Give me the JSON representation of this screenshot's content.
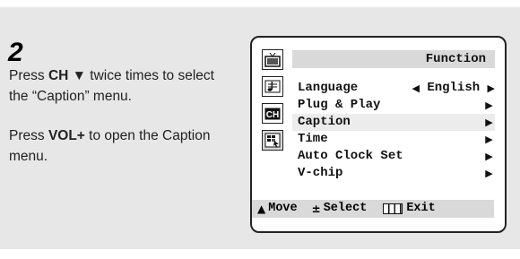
{
  "step": {
    "number": "2"
  },
  "instructions": [
    {
      "before": "Press ",
      "bold": "CH ▼",
      "after": " twice times to select the “Caption” menu."
    },
    {
      "before": "Press ",
      "bold": "VOL+",
      "after": " to open the Caption menu."
    }
  ],
  "osd": {
    "icons": [
      "tv-picture-icon",
      "music-note-icon",
      "ch-icon",
      "function-grid-icon"
    ],
    "active_icon": "function-grid-icon",
    "menu_title": "Function",
    "items": [
      {
        "label": "Language",
        "value": "English",
        "has_left_arrow": true
      },
      {
        "label": "Plug & Play",
        "value": "",
        "has_left_arrow": false
      },
      {
        "label": "Caption",
        "value": "",
        "has_left_arrow": false,
        "selected": true
      },
      {
        "label": "Time",
        "value": "",
        "has_left_arrow": false
      },
      {
        "label": "Auto Clock Set",
        "value": "",
        "has_left_arrow": false
      },
      {
        "label": "V-chip",
        "value": "",
        "has_left_arrow": false
      }
    ],
    "footer": {
      "move": "Move",
      "select": "Select",
      "exit": "Exit"
    },
    "ch_icon_text": "CH"
  }
}
